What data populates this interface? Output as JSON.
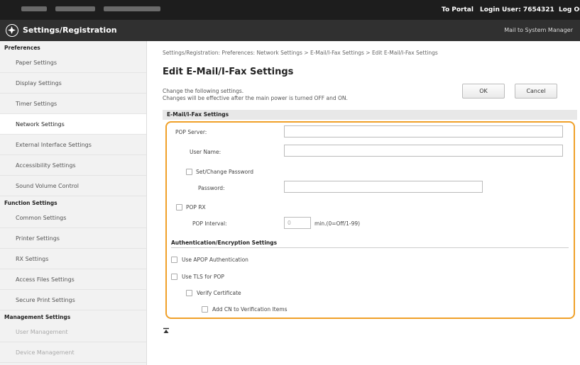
{
  "topbar": {
    "portal": "To Portal",
    "login_user": "Login User: 7654321",
    "logout": "Log Out"
  },
  "header": {
    "title": "Settings/Registration",
    "mail_link": "Mail to System Manager",
    "logo_icon": "settings-logo-icon"
  },
  "sidebar": {
    "sections": [
      {
        "title": "Preferences",
        "items": [
          "Paper Settings",
          "Display Settings",
          "Timer Settings",
          "Network Settings",
          "External Interface Settings",
          "Accessibility Settings",
          "Sound Volume Control"
        ]
      },
      {
        "title": "Function Settings",
        "items": [
          "Common Settings",
          "Printer Settings",
          "RX Settings",
          "Access Files Settings",
          "Secure Print Settings"
        ]
      },
      {
        "title": "Management Settings",
        "items": [
          "User Management",
          "Device Management"
        ]
      }
    ],
    "active_item": "Network Settings"
  },
  "main": {
    "breadcrumb": "Settings/Registration: Preferences: Network Settings > E-Mail/I-Fax Settings > Edit E-Mail/I-Fax Settings",
    "title": "Edit E-Mail/I-Fax Settings",
    "desc_line1": "Change the following settings.",
    "desc_line2": "Changes will be effective after the main power is turned OFF and ON.",
    "ok_label": "OK",
    "cancel_label": "Cancel",
    "section_title": "E-Mail/I-Fax Settings",
    "pop_server_label": "POP Server:",
    "pop_server_value": "",
    "user_name_label": "User Name:",
    "user_name_value": "",
    "set_change_password_label": "Set/Change Password",
    "password_label": "Password:",
    "password_value": "",
    "pop_rx_label": "POP RX",
    "pop_interval_label": "POP Interval:",
    "pop_interval_value": "0",
    "pop_interval_unit": "min.(0=Off/1-99)",
    "auth_title": "Authentication/Encryption Settings",
    "use_apop_label": "Use APOP Authentication",
    "use_tls_label": "Use TLS for POP",
    "verify_cert_label": "Verify Certificate",
    "add_cn_label": "Add CN to Verification Items",
    "top_anchor_icon": "scroll-to-top-icon"
  }
}
